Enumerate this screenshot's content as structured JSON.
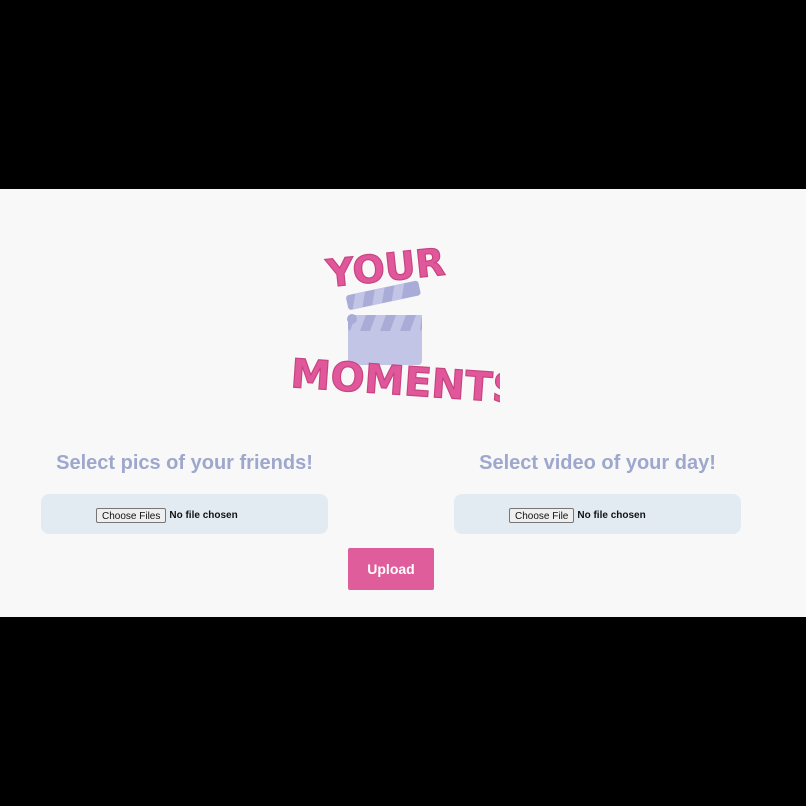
{
  "logo": {
    "line1": "YOUR",
    "line2": "MOMENTS",
    "icon": "clapperboard-icon"
  },
  "pics_section": {
    "title": "Select pics of your friends!",
    "button_label": "Choose Files",
    "status": "No file chosen"
  },
  "video_section": {
    "title": "Select video of your day!",
    "button_label": "Choose File",
    "status": "No file chosen"
  },
  "upload": {
    "label": "Upload"
  },
  "colors": {
    "brand_pink": "#df5d9a",
    "heading_lavender": "#9ea7cc",
    "panel_blue": "#e3ebf2",
    "background": "#f8f8f9",
    "clapper_lavender": "#c3c5e6"
  }
}
